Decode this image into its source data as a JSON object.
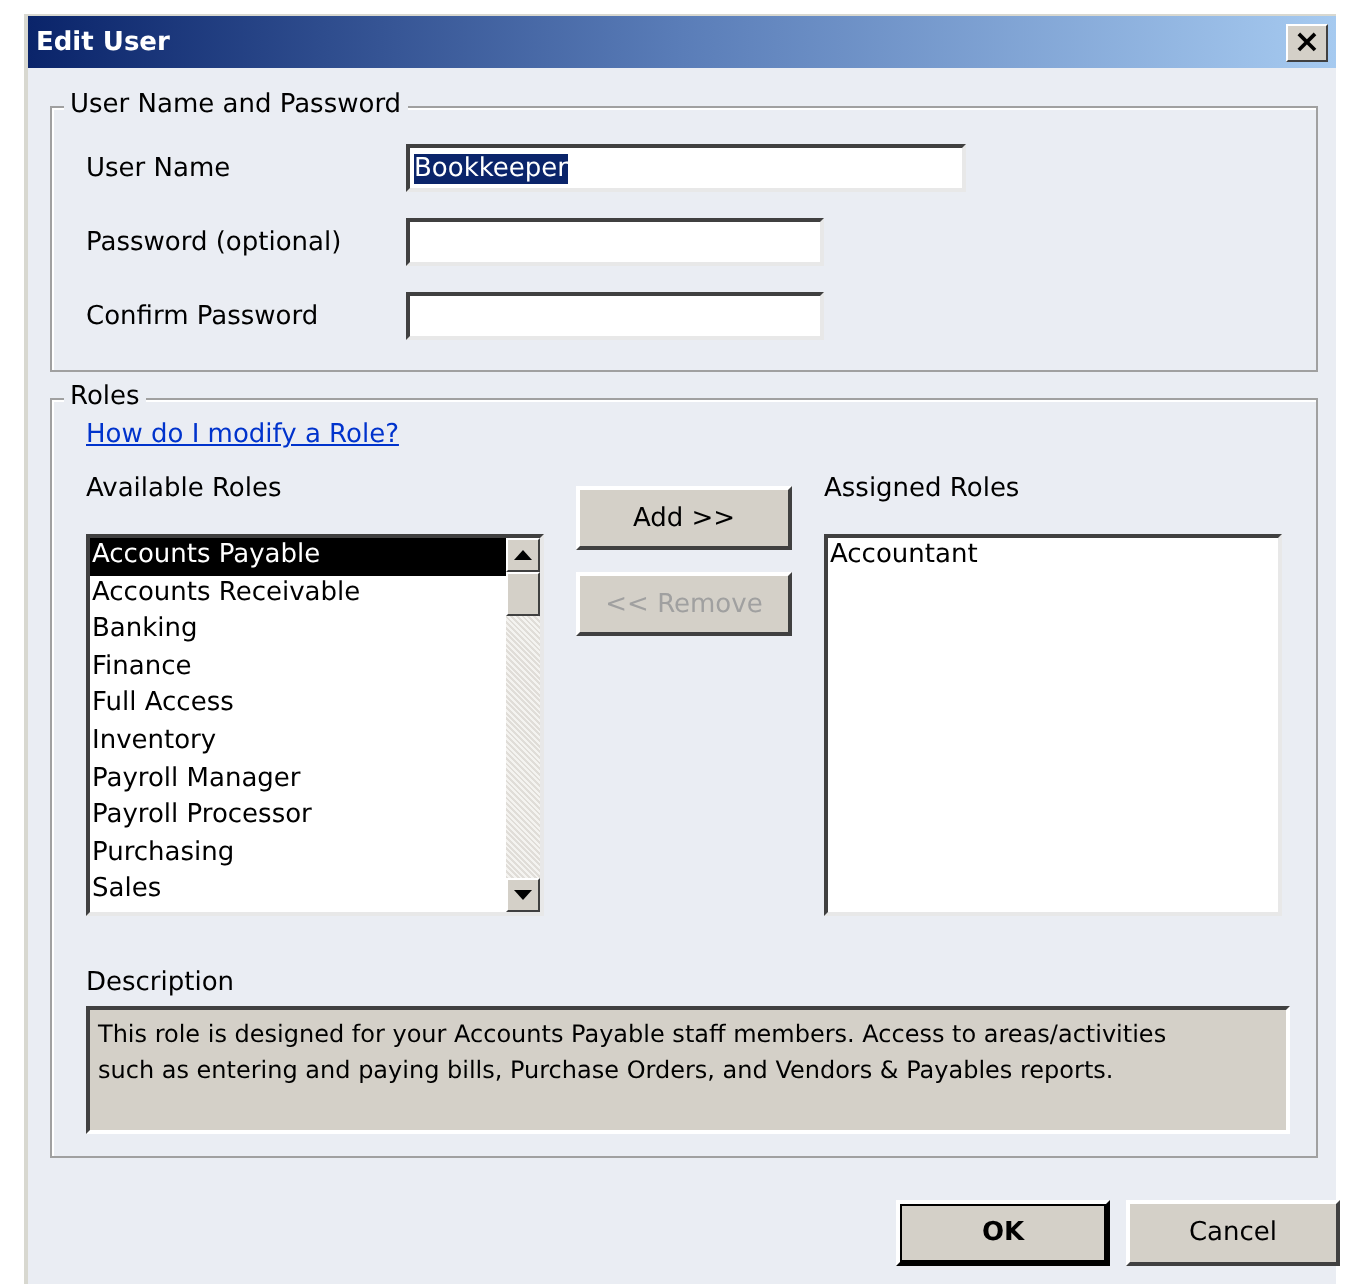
{
  "window": {
    "title": "Edit User",
    "close": "×"
  },
  "credentials": {
    "legend": "User Name and Password",
    "fields": [
      {
        "label": "User Name",
        "value": "Bookkeeper",
        "kind": "wide",
        "selected": true
      },
      {
        "label": "Password (optional)",
        "kind": "narrow"
      },
      {
        "label": "Confirm Password",
        "kind": "narrow"
      }
    ]
  },
  "roles": {
    "legend": "Roles",
    "help_link": "How do I modify a Role?",
    "available": {
      "label": "Available Roles",
      "items": [
        {
          "text": "Accounts Payable",
          "selected": true
        },
        {
          "text": "Accounts Receivable",
          "selected": false
        },
        {
          "text": "Banking",
          "selected": false
        },
        {
          "text": "Finance",
          "selected": false
        },
        {
          "text": "Full Access",
          "selected": false
        },
        {
          "text": "Inventory",
          "selected": false
        },
        {
          "text": "Payroll Manager",
          "selected": false
        },
        {
          "text": "Payroll Processor",
          "selected": false
        },
        {
          "text": "Purchasing",
          "selected": false
        },
        {
          "text": "Sales",
          "selected": false
        }
      ]
    },
    "actions": [
      {
        "label": "Add >>",
        "disabled": false
      },
      {
        "label": "<< Remove",
        "disabled": true
      }
    ],
    "assigned": {
      "label": "Assigned Roles",
      "items": [
        {
          "text": "Accountant",
          "selected": false
        }
      ]
    },
    "description": {
      "label": "Description",
      "text": "This role is designed for your Accounts Payable staff members. Access to areas/activities such as entering and paying bills, Purchase Orders, and Vendors & Payables reports."
    }
  },
  "buttons": [
    {
      "label": "OK",
      "default": true
    },
    {
      "label": "Cancel",
      "default": false
    }
  ]
}
